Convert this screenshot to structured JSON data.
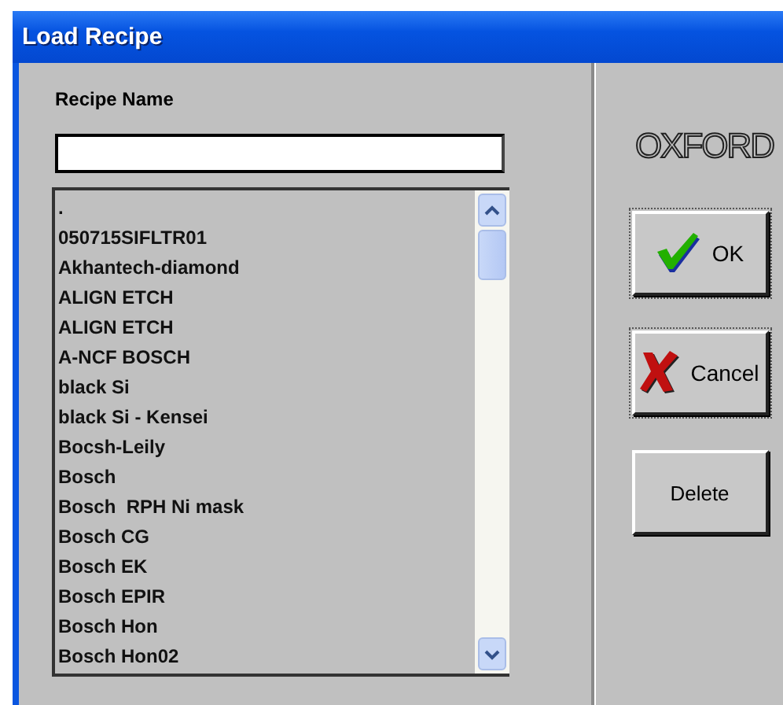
{
  "window": {
    "title": "Load Recipe"
  },
  "recipe_name": {
    "label": "Recipe Name"
  },
  "recipes": [
    ".",
    "050715SIFLTR01",
    "Akhantech-diamond",
    "ALIGN ETCH",
    "ALIGN ETCH",
    "A-NCF BOSCH",
    "black Si",
    "black Si - Kensei",
    "Bocsh-Leily",
    "Bosch",
    "Bosch  RPH Ni mask",
    "Bosch CG",
    "Bosch EK",
    "Bosch EPIR",
    "Bosch Hon",
    "Bosch Hon02"
  ],
  "logo": "OXFORD",
  "buttons": [
    {
      "kind": "ok",
      "label": "OK"
    },
    {
      "kind": "cancel",
      "label": "Cancel"
    },
    {
      "kind": "plain",
      "label": "Delete"
    }
  ]
}
